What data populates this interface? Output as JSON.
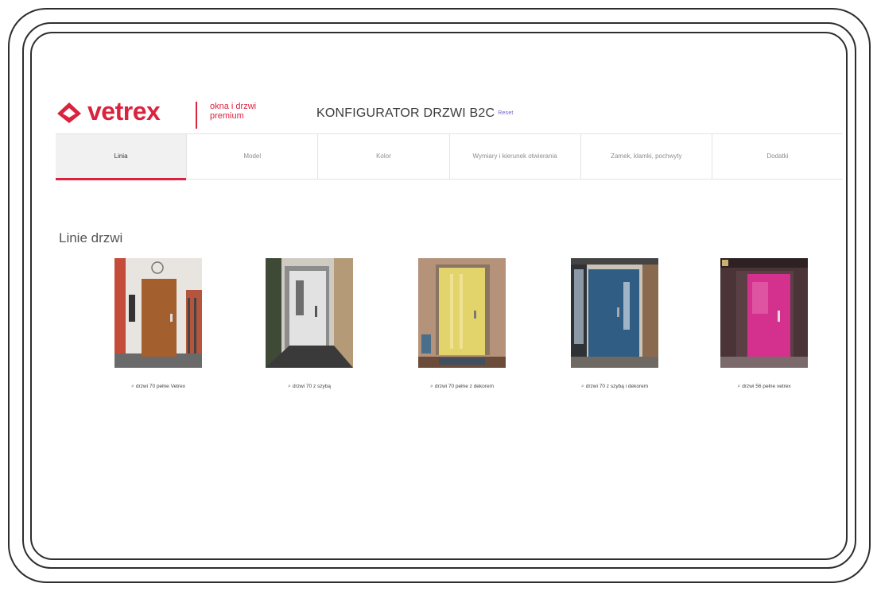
{
  "header": {
    "brand": "vetrex",
    "tagline": "okna i drzwi premium",
    "title": "KONFIGURATOR DRZWI B2C",
    "reset": "Reset"
  },
  "tabs": [
    {
      "label": "Linia",
      "active": true
    },
    {
      "label": "Model",
      "active": false
    },
    {
      "label": "Kolor",
      "active": false
    },
    {
      "label": "Wymiary i kierunek otwierania",
      "active": false
    },
    {
      "label": "Zamek, klamki, pochwyty",
      "active": false
    },
    {
      "label": "Dodatki",
      "active": false
    }
  ],
  "section": {
    "title": "Linie drzwi"
  },
  "doors": [
    {
      "caption": "drzwi 70 pełne Vetrex",
      "icon": "magnifier-icon",
      "door_color": "#a35f2e"
    },
    {
      "caption": "drzwi 70 z szybą",
      "icon": "magnifier-icon",
      "door_color": "#d9d9d9"
    },
    {
      "caption": "drzwi 70 pełne z dekorem",
      "icon": "magnifier-icon",
      "door_color": "#e2d46a"
    },
    {
      "caption": "drzwi 70 z szybą i dekorem",
      "icon": "magnifier-icon",
      "door_color": "#2f5d84"
    },
    {
      "caption": "drzwi 56 pełne vetrex",
      "icon": "magnifier-icon",
      "door_color": "#d4318e"
    }
  ],
  "colors": {
    "accent": "#d9233f",
    "link": "#6c63c7"
  }
}
